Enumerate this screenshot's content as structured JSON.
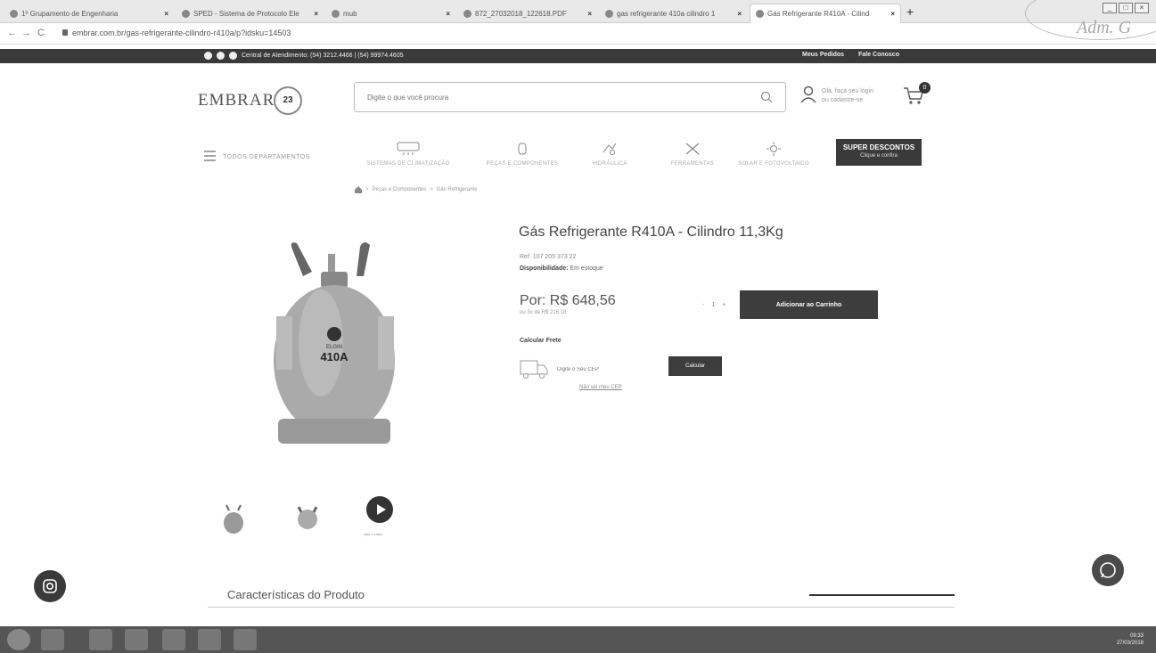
{
  "browser": {
    "tabs": [
      {
        "label": "1º Grupamento de Engenharia",
        "active": false
      },
      {
        "label": "SPED - Sistema de Protocolo Ele",
        "active": false
      },
      {
        "label": "mub",
        "active": false
      },
      {
        "label": "872_27032018_122618.PDF",
        "active": false
      },
      {
        "label": "gas refrigerante 410a cilindro 1",
        "active": false
      },
      {
        "label": "Gás Refrigerante R410A - Cilind",
        "active": true
      }
    ],
    "url": "embrar.com.br/gas-refrigerante-cilindro-r410a/p?idsku=14503"
  },
  "topbar": {
    "contact": "Central de Atendimento: (54) 3212.4466 | (54) 99974.4605",
    "orders": "Meus Pedidos",
    "contact_us": "Fale Conosco"
  },
  "header": {
    "logo": "EMBRAR",
    "logo_badge": "23",
    "search_placeholder": "Digite o que você procura",
    "login_line1": "Olá, faça seu login",
    "login_line2": "ou cadastre-se",
    "cart_count": "0"
  },
  "departments": {
    "all_label": "TODOS DEPARTAMENTOS",
    "items": [
      {
        "label": "SISTEMAS DE CLIMATIZAÇÃO",
        "icon": "air-conditioner-icon"
      },
      {
        "label": "PEÇAS E COMPONENTES",
        "icon": "component-icon"
      },
      {
        "label": "HIDRÁULICA",
        "icon": "hydraulic-icon"
      },
      {
        "label": "FERRAMENTAS",
        "icon": "tools-icon"
      },
      {
        "label": "SOLAR E FOTOVOLTAICO",
        "icon": "solar-icon"
      }
    ],
    "promo_title": "SUPER DESCONTOS",
    "promo_sub": "Clique e confira"
  },
  "breadcrumb": {
    "items": [
      "Peças e Componentes",
      "Gás Refrigerante"
    ]
  },
  "product": {
    "title": "Gás Refrigerante R410A - Cilindro 11,3Kg",
    "ref": "Ref. 107 205 373 22",
    "availability_label": "Disponibilidade:",
    "availability_value": "Em estoque",
    "price": "Por: R$ 648,56",
    "installments": "ou 3x de R$ 216,18",
    "quantity": "1",
    "qty_minus": "-",
    "qty_plus": "+",
    "add_to_cart": "Adicionar ao Carrinho",
    "cylinder_label": "410A",
    "cylinder_brand": "ELGIN"
  },
  "shipping": {
    "title": "Calcular Frete",
    "cep_placeholder": "Digite o Seu CEP",
    "calc_button": "Calcular",
    "no_cep": "Não sei meu CEP"
  },
  "media": {
    "video_label": "veja o vídeo"
  },
  "characteristics": {
    "title": "Características do Produto"
  },
  "taskbar": {
    "time": "09:33",
    "date": "27/03/2018"
  },
  "stamp": {
    "text": "Adm. G"
  }
}
